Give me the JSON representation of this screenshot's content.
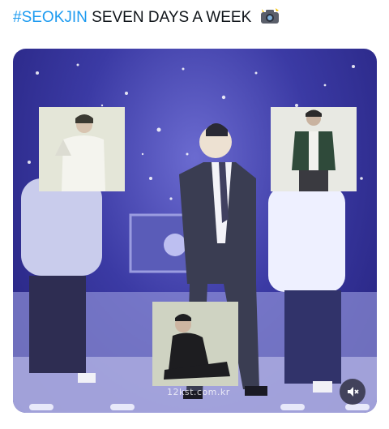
{
  "post": {
    "hashtag": "#SEOKJIN",
    "text": " SEVEN DAYS A WEEK",
    "emoji_icon": "camera-flash-icon"
  },
  "media": {
    "watermark": "12kst.com.kr",
    "mute_icon": "muted-speaker-icon",
    "colors": {
      "stage_bg": "#3b3aa4",
      "stage_floor": "#8d8fd6",
      "suit": "#3a3d52"
    }
  }
}
